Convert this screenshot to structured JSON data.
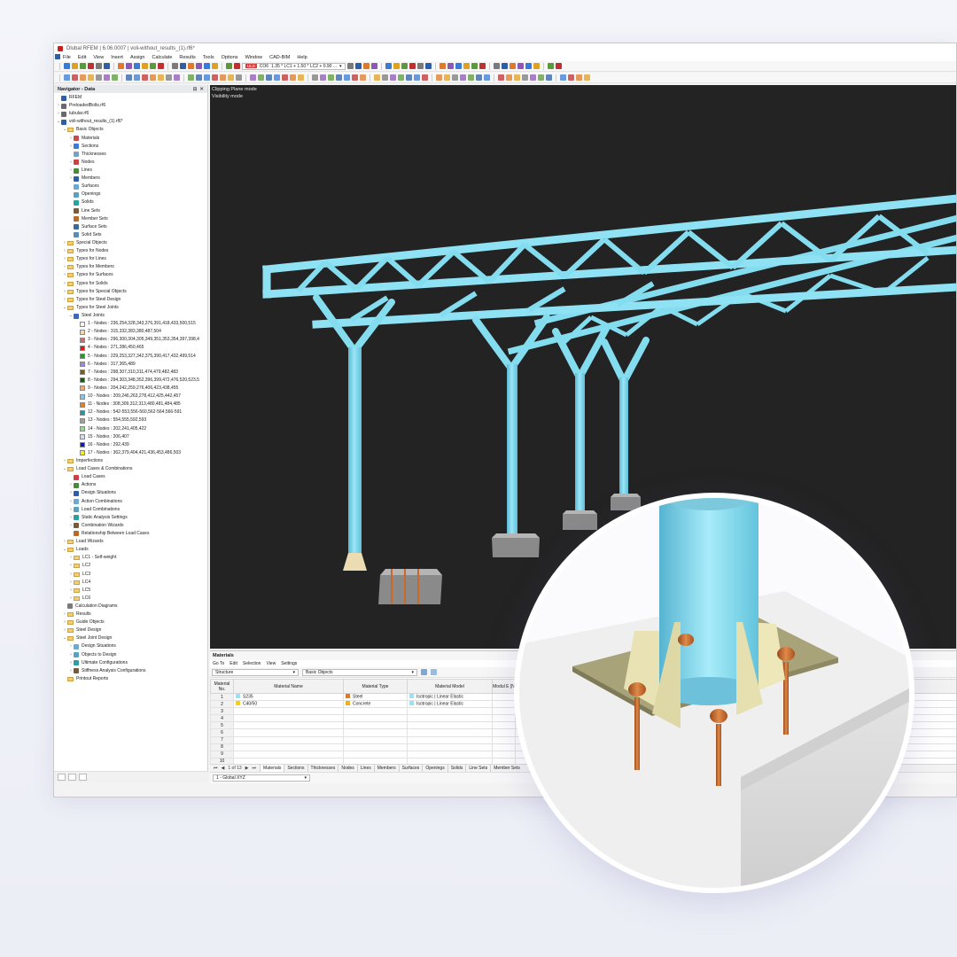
{
  "window": {
    "title": "Dlubal RFEM | 6.06.0007 | voli-without_results_(1).rf6*"
  },
  "menu": [
    "File",
    "Edit",
    "View",
    "Insert",
    "Assign",
    "Calculate",
    "Results",
    "Tools",
    "Options",
    "Window",
    "CAD-BIM",
    "Help"
  ],
  "toolbar": {
    "ls_tag": "ULS",
    "combo_id": "CO6",
    "combo_text": "1.35 * LC1 + 1.50 * LC2 + 0.90 ..."
  },
  "navigator": {
    "title": "Navigator - Data",
    "root": "RFEM",
    "files": [
      {
        "label": "PreloadedBolts.rf6"
      },
      {
        "label": "tubular.rf6"
      },
      {
        "label": "voli-without_results_(1).rf6*"
      }
    ],
    "basic_objects": {
      "label": "Basic Objects",
      "items": [
        "Materials",
        "Sections",
        "Thicknesses",
        "Nodes",
        "Lines",
        "Members",
        "Surfaces",
        "Openings",
        "Solids",
        "Line Sets",
        "Member Sets",
        "Surface Sets",
        "Solid Sets"
      ]
    },
    "type_folders": [
      "Special Objects",
      "Types for Nodes",
      "Types for Lines",
      "Types for Members",
      "Types for Surfaces",
      "Types for Solids",
      "Types for Special Objects",
      "Types for Steel Design",
      "Types for Steel Joints"
    ],
    "steel_joints": {
      "label": "Steel Joints",
      "items": [
        {
          "label": "1 - Nodes : 236,254,328,343,376,391,418,433,500,515",
          "color": "#ffffff"
        },
        {
          "label": "2 - Nodes : 315,332,383,380,487,504",
          "color": "#f0d8b0"
        },
        {
          "label": "3 - Nodes : 296,300,304,305,349,351,353,354,397,398,4",
          "color": "#c87070"
        },
        {
          "label": "4 - Nodes : 271,286,450,465",
          "color": "#e01818"
        },
        {
          "label": "5 - Nodes : 229,253,327,342,375,390,417,432,499,514",
          "color": "#1aa01a"
        },
        {
          "label": "6 - Nodes : 317,365,489",
          "color": "#a088d8"
        },
        {
          "label": "7 - Nodes : 298,307,310,311,474,479,482,483",
          "color": "#7b5c1e"
        },
        {
          "label": "8 - Nodes : 294,303,348,352,396,399,472,476,520,523,5",
          "color": "#145a14"
        },
        {
          "label": "9 - Nodes : 204,242,259,276,406,423,438,455",
          "color": "#f4a870"
        },
        {
          "label": "10 - Nodes : 209,246,263,278,412,425,442,457",
          "color": "#7fc8f0"
        },
        {
          "label": "11 - Nodes : 308,309,312,313,480,481,484,485",
          "color": "#e8801e"
        },
        {
          "label": "12 - Nodes : 542-553,556-560,562-564,566-591",
          "color": "#1e9898"
        },
        {
          "label": "13 - Nodes : 554,555,592,593",
          "color": "#a0a0a0"
        },
        {
          "label": "14 - Nodes : 202,241,405,422",
          "color": "#98d890"
        },
        {
          "label": "15 - Nodes : 206,407",
          "color": "#d8d8f0"
        },
        {
          "label": "16 - Nodes : 292,439",
          "color": "#1a1aa8"
        },
        {
          "label": "17 - Nodes : 362,379,404,421,436,453,486,503",
          "color": "#f0f028"
        }
      ]
    },
    "imperfections": "Imperfections",
    "load_cases": {
      "label": "Load Cases & Combinations",
      "items": [
        "Load Cases",
        "Actions",
        "Design Situations",
        "Action Combinations",
        "Load Combinations",
        "Static Analysis Settings",
        "Combination Wizards",
        "Relationship Between Load Cases"
      ]
    },
    "load_wizards": "Load Wizards",
    "loads": {
      "label": "Loads",
      "items": [
        "LC1 - Self-weight",
        "LC2",
        "LC3",
        "LC4",
        "LC5",
        "LC6"
      ]
    },
    "bottom_folders": [
      "Calculation Diagrams",
      "Results",
      "Guide Objects",
      "Steel Design"
    ],
    "steel_joint_design": {
      "label": "Steel Joint Design",
      "items": [
        "Design Situations",
        "Objects to Design",
        "Ultimate Configurations",
        "Stiffness Analysis Configurations"
      ]
    },
    "printout": "Printout Reports"
  },
  "view": {
    "line1": "Clipping Plane mode",
    "line2": "Visibility mode"
  },
  "materials_panel": {
    "title": "Materials",
    "menu": [
      "Go To",
      "Edit",
      "Selection",
      "View",
      "Settings"
    ],
    "filter": "Structure",
    "objects": "Basic Objects",
    "headers": {
      "no": "Material\nNo.",
      "name": "Material Name",
      "type": "Material\nType",
      "model": "Material Model",
      "modulus": "Modul\nE [N"
    },
    "rows": [
      {
        "no": "1",
        "name": "S235",
        "name_color": "#9fe0f5",
        "type": "Steel",
        "type_color": "#e07a2a",
        "model": "Isotropic | Linear Elastic",
        "model_color": "#9fe0f5"
      },
      {
        "no": "2",
        "name": "C40/50",
        "name_color": "#f2d020",
        "type": "Concrete",
        "type_color": "#f0b020",
        "model": "Isotropic | Linear Elastic",
        "model_color": "#9fe0f5"
      },
      {
        "no": "3"
      },
      {
        "no": "4"
      },
      {
        "no": "5"
      },
      {
        "no": "6"
      },
      {
        "no": "7"
      },
      {
        "no": "8"
      },
      {
        "no": "9"
      },
      {
        "no": "10"
      },
      {
        "no": "11"
      }
    ],
    "pager": "1 of 13",
    "tabs": [
      "Materials",
      "Sections",
      "Thicknesses",
      "Nodes",
      "Lines",
      "Members",
      "Surfaces",
      "Openings",
      "Solids",
      "Line Sets",
      "Member Sets"
    ]
  },
  "status": {
    "coord_system": "1 - Global XYZ"
  },
  "colors": {
    "steel": "#84dcef",
    "dark_bg": "#232323",
    "concrete": "#d9d9d9",
    "anchor": "#c8692a"
  }
}
